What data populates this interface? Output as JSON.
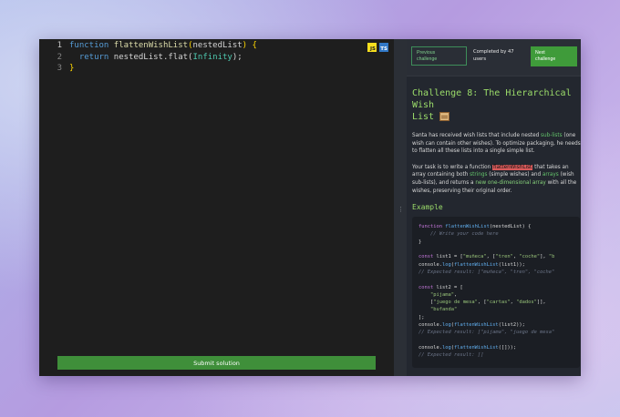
{
  "editor": {
    "lines": [
      {
        "n": "1",
        "kw": "function",
        "fn": " flattenWishList",
        "open": "(",
        "param": "nestedList",
        "close": ")",
        "tail": " {"
      },
      {
        "n": "2",
        "kw2": "return",
        "body": " nestedList.flat(",
        "num": "Infinity",
        "end": ");"
      },
      {
        "n": "3",
        "brace": "}"
      }
    ],
    "lang_js": "JS",
    "lang_ts": "TS",
    "submit_label": "Submit solution"
  },
  "topbar": {
    "prev_line1": "Previous",
    "prev_line2": "challenge",
    "completed_line1": "Completed by 47",
    "completed_line2": "users",
    "next_line1": "Next",
    "next_line2": "challenge"
  },
  "challenge": {
    "title_line1": "Challenge 8: The Hierarchical Wish",
    "title_line2": "List",
    "p1_a": "Santa has received wish lists that include nested ",
    "p1_b": "sub-lists",
    "p1_c": " (one wish can contain other wishes). To optimize packaging, he needs to flatten all these lists into a single simple list.",
    "p2_a": "Your task is to write a function ",
    "p2_b": "flattenWishList",
    "p2_c": " that takes an array containing both ",
    "p2_d": "strings",
    "p2_e": " (simple wishes) and ",
    "p2_f": "arrays",
    "p2_g": " (wish sub-lists), and returns a ",
    "p2_h": "new one-dimensional array",
    "p2_i": " with all the wishes, preserving their original order.",
    "example_title": "Example"
  },
  "example_code": {
    "l1_k": "function ",
    "l1_f": "flattenWishList",
    "l1_p": "(nestedList) {",
    "l2_c": "    // Write your code here",
    "l3_p": "}",
    "l5_k": "const ",
    "l5_p": "list1 = [",
    "l5_s1": "\"muñeca\"",
    "l5_p2": ", [",
    "l5_s2": "\"tren\"",
    "l5_p3": ", ",
    "l5_s3": "\"coche\"",
    "l5_p4": "], ",
    "l5_s4": "\"b",
    "l6_p": "console.",
    "l6_f": "log",
    "l6_p2": "(",
    "l6_f2": "flattenWishList",
    "l6_p3": "(list1));",
    "l7_c": "// Expected result: [\"muñeca\", \"tren\", \"coche\"",
    "l9_k": "const ",
    "l9_p": "list2 = [",
    "l10_s": "    \"pijama\"",
    "l10_p": ",",
    "l11_p": "    [",
    "l11_s1": "\"juego de mesa\"",
    "l11_p2": ", [",
    "l11_s2": "\"cartas\"",
    "l11_p3": ", ",
    "l11_s3": "\"dados\"",
    "l11_p4": "]],",
    "l12_s": "    \"bufanda\"",
    "l13_p": "];",
    "l14_p": "console.",
    "l14_f": "log",
    "l14_p2": "(",
    "l14_f2": "flattenWishList",
    "l14_p3": "(list2));",
    "l15_c": "// Expected result: [\"pijama\", \"juego de mesa\"",
    "l17_p": "console.",
    "l17_f": "log",
    "l17_p2": "(",
    "l17_f2": "flattenWishList",
    "l17_p3": "([]));",
    "l18_c": "// Expected result: []"
  },
  "colors": {
    "accent": "#3f9b3a",
    "title": "#9bdc6a",
    "editor_bg": "#1e1e1e",
    "panel_bg": "#23272f"
  },
  "icons": {
    "divider": "drag-grip-icon",
    "title": "scroll-icon"
  }
}
